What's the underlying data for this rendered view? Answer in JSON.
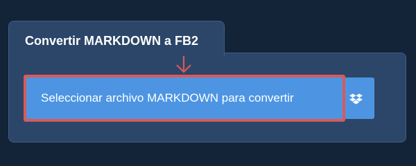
{
  "tab": {
    "title": "Convertir MARKDOWN a FB2"
  },
  "upload": {
    "select_label": "Seleccionar archivo MARKDOWN para convertir",
    "dropbox_icon": "dropbox-icon",
    "pointer_icon": "arrow-down-icon"
  },
  "colors": {
    "background": "#132338",
    "panel": "#2b4668",
    "button": "#4d95e3",
    "highlight": "#d95a58"
  }
}
